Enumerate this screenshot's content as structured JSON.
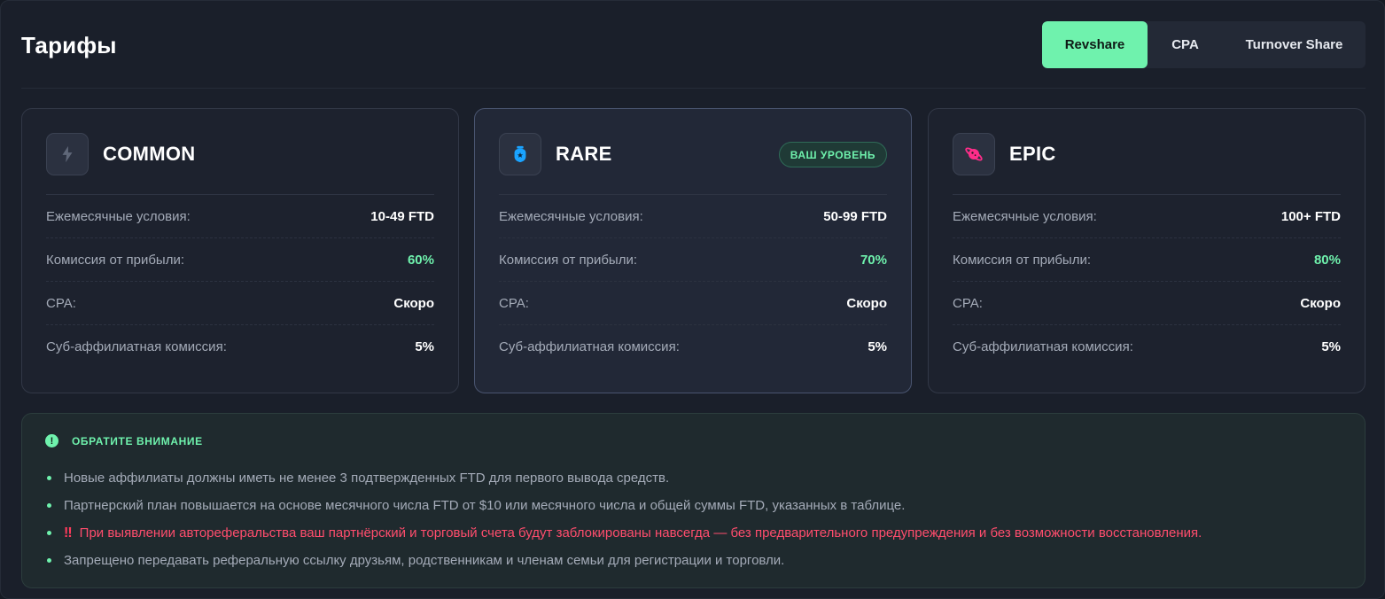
{
  "page": {
    "title": "Тарифы"
  },
  "tabs": [
    {
      "label": "Revshare",
      "active": true
    },
    {
      "label": "CPA",
      "active": false
    },
    {
      "label": "Turnover Share",
      "active": false
    }
  ],
  "cards": [
    {
      "title": "COMMON",
      "icon": "lightning-icon",
      "badge": "",
      "rows": [
        {
          "label": "Ежемесячные условия:",
          "value": "10-49 FTD"
        },
        {
          "label": "Комиссия от прибыли:",
          "value": "60%"
        },
        {
          "label": "CPA:",
          "value": "Скоро"
        },
        {
          "label": "Суб-аффилиатная комиссия:",
          "value": "5%"
        }
      ]
    },
    {
      "title": "RARE",
      "icon": "shield-star-icon",
      "badge": "ВАШ УРОВЕНЬ",
      "rows": [
        {
          "label": "Ежемесячные условия:",
          "value": "50-99 FTD"
        },
        {
          "label": "Комиссия от прибыли:",
          "value": "70%"
        },
        {
          "label": "CPA:",
          "value": "Скоро"
        },
        {
          "label": "Суб-аффилиатная комиссия:",
          "value": "5%"
        }
      ]
    },
    {
      "title": "EPIC",
      "icon": "planet-icon",
      "badge": "",
      "rows": [
        {
          "label": "Ежемесячные условия:",
          "value": "100+ FTD"
        },
        {
          "label": "Комиссия от прибыли:",
          "value": "80%"
        },
        {
          "label": "CPA:",
          "value": "Скоро"
        },
        {
          "label": "Суб-аффилиатная комиссия:",
          "value": "5%"
        }
      ]
    }
  ],
  "notice": {
    "title": "ОБРАТИТЕ ВНИМАНИЕ",
    "items": [
      "Новые аффилиаты должны иметь не менее 3 подтвержденных FTD для первого вывода средств.",
      "Партнерский план повышается на основе месячного числа FTD от $10 или месячного числа и общей суммы FTD, указанных в таблице.",
      "При выявлении автореферальства ваш партнёрский и торговый счета будут заблокированы навсегда — без предварительного предупреждения и без возможности восстановления.",
      "Запрещено передавать реферальную ссылку друзьям, родственникам и членам семьи для регистрации и торговли."
    ]
  },
  "colors": {
    "accent": "#6ff2ad",
    "warning": "#ff4d6d",
    "background": "#1a1f2a"
  }
}
